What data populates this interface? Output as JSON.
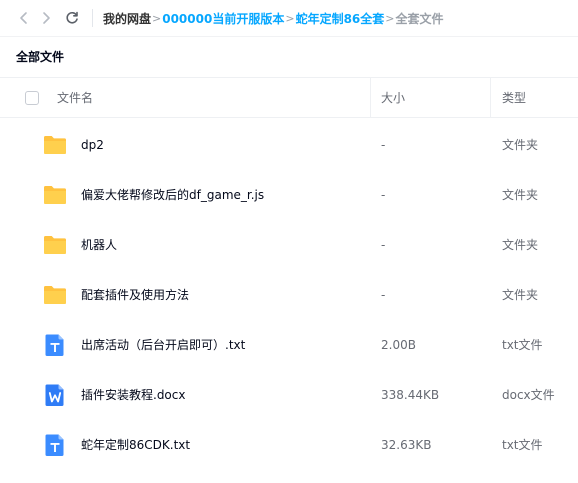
{
  "colors": {
    "accent": "#06a7ff",
    "folder": "#ffc23f",
    "txt_icon": "#3b8cff",
    "docx_icon": "#2f7cf6"
  },
  "toolbar": {
    "back_icon": "chevron-left-icon",
    "forward_icon": "chevron-right-icon",
    "refresh_icon": "refresh-icon"
  },
  "breadcrumb": {
    "root": "我的网盘",
    "items": [
      "000000当前开服版本",
      "蛇年定制86全套"
    ],
    "current": "全套文件",
    "separator": ">"
  },
  "section_title": "全部文件",
  "table": {
    "headers": {
      "name": "文件名",
      "size": "大小",
      "type": "类型"
    },
    "rows": [
      {
        "icon": "folder-icon",
        "name": "dp2",
        "size": "-",
        "type": "文件夹"
      },
      {
        "icon": "folder-icon",
        "name": "偏爱大佬帮修改后的df_game_r.js",
        "size": "-",
        "type": "文件夹"
      },
      {
        "icon": "folder-icon",
        "name": "机器人",
        "size": "-",
        "type": "文件夹"
      },
      {
        "icon": "folder-icon",
        "name": "配套插件及使用方法",
        "size": "-",
        "type": "文件夹"
      },
      {
        "icon": "txt-file-icon",
        "name": "出席活动（后台开启即可）.txt",
        "size": "2.00B",
        "type": "txt文件"
      },
      {
        "icon": "docx-file-icon",
        "name": "插件安装教程.docx",
        "size": "338.44KB",
        "type": "docx文件"
      },
      {
        "icon": "txt-file-icon",
        "name": "蛇年定制86CDK.txt",
        "size": "32.63KB",
        "type": "txt文件"
      }
    ]
  }
}
